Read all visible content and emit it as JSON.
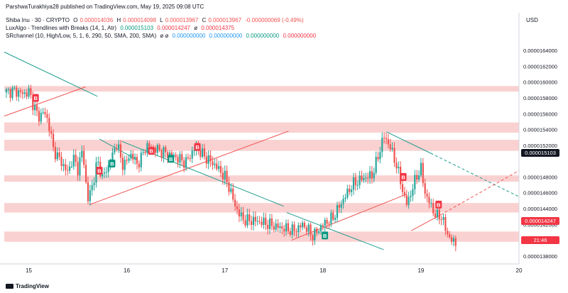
{
  "header": {
    "published": "ParshwaTurakhiya28 published on TradingView.com, May 19, 2025 09:08 UTC",
    "symbol": "Shiba Inu · 30 · CRYPTO",
    "ohlc": [
      {
        "k": "O",
        "v": "0.000014036"
      },
      {
        "k": "H",
        "v": "0.000014098"
      },
      {
        "k": "L",
        "v": "0.000013967"
      },
      {
        "k": "C",
        "v": "0.000013967"
      }
    ],
    "change": "-0.000000069 (-0.49%)",
    "ind1_name": "LuxAlgo - Trendlines with Breaks (14, 1, Atr)",
    "ind1_v1": "0.000015103",
    "ind1_v2": "0.000014247",
    "ind1_v3": "0.000014375",
    "ind1_sym": "ø",
    "ind2_name": "SRchannel (10, High/Low, 5, 1, 6, 290, 50, SMA, 200, SMA)",
    "ind2_sym": "ø ø",
    "ind2_values": [
      "0.000000000",
      "0.000000000",
      "0.000000000",
      "0.000000000"
    ],
    "currency": "USD",
    "footer": "TradingView"
  },
  "colors": {
    "up": "#26a69a",
    "down": "#ef5350",
    "zone": "#f9c9c9",
    "trend_down": "#1e9e8e",
    "trend_up": "#ef5350",
    "break_up": "#089981",
    "break_down": "#f23645",
    "axis_text": "#131722"
  },
  "chart_data": {
    "type": "candlestick",
    "symbol": "Shiba Inu · 30 · CRYPTO",
    "x_ticks": [
      "15",
      "16",
      "17",
      "18",
      "19",
      "20"
    ],
    "x_tick_days": [
      15,
      16,
      17,
      18,
      19,
      20
    ],
    "x_range_days": [
      14.75,
      20
    ],
    "y_range": [
      1.37e-05,
      1.65e-05
    ],
    "y_ticks": [
      {
        "v": 1.64e-05,
        "label": "0.0000164000"
      },
      {
        "v": 1.62e-05,
        "label": "0.0000162000"
      },
      {
        "v": 1.6e-05,
        "label": "0.0000160000"
      },
      {
        "v": 1.58e-05,
        "label": "0.0000158000"
      },
      {
        "v": 1.56e-05,
        "label": "0.0000156000"
      },
      {
        "v": 1.54e-05,
        "label": "0.0000154000"
      },
      {
        "v": 1.52e-05,
        "label": "0.0000152000"
      },
      {
        "v": 1.48e-05,
        "label": "0.0000148000"
      },
      {
        "v": 1.46e-05,
        "label": "0.0000146000"
      },
      {
        "v": 1.44e-05,
        "label": "0.0000144000"
      },
      {
        "v": 1.42e-05,
        "label": "0.0000142000"
      },
      {
        "v": 1.4e-05,
        "label": "0.0000140000"
      },
      {
        "v": 1.38e-05,
        "label": "0.0000138000"
      }
    ],
    "price_labels": [
      {
        "text": "0.000015103",
        "v": 1.5103e-05,
        "style": "box-dark"
      },
      {
        "text": "0.000014247",
        "v": 1.4247e-05,
        "style": "red"
      },
      {
        "text": "21:46",
        "v": 1.4e-05,
        "style": "red"
      }
    ],
    "zones": [
      [
        1.588e-05,
        1.595e-05
      ],
      [
        1.536e-05,
        1.549e-05
      ],
      [
        1.513e-05,
        1.527e-05
      ],
      [
        1.474e-05,
        1.482e-05
      ],
      [
        1.435e-05,
        1.447e-05
      ],
      [
        1.398e-05,
        1.411e-05
      ]
    ],
    "close_path": [
      [
        14.75,
        15.87
      ],
      [
        14.85,
        15.89
      ],
      [
        14.95,
        15.85
      ],
      [
        15.0,
        15.88
      ],
      [
        15.05,
        15.7
      ],
      [
        15.1,
        15.55
      ],
      [
        15.15,
        15.63
      ],
      [
        15.2,
        15.5
      ],
      [
        15.25,
        15.15
      ],
      [
        15.3,
        15.05
      ],
      [
        15.35,
        14.95
      ],
      [
        15.4,
        14.85
      ],
      [
        15.45,
        15.05
      ],
      [
        15.5,
        14.9
      ],
      [
        15.55,
        15.15
      ],
      [
        15.6,
        14.5
      ],
      [
        15.65,
        14.7
      ],
      [
        15.7,
        15.0
      ],
      [
        15.75,
        14.8
      ],
      [
        15.8,
        14.9
      ],
      [
        15.85,
        15.05
      ],
      [
        15.9,
        15.25
      ],
      [
        15.95,
        14.95
      ],
      [
        16.0,
        15.0
      ],
      [
        16.05,
        15.1
      ],
      [
        16.1,
        14.95
      ],
      [
        16.15,
        15.05
      ],
      [
        16.2,
        15.2
      ],
      [
        16.3,
        15.15
      ],
      [
        16.4,
        15.1
      ],
      [
        16.5,
        15.05
      ],
      [
        16.6,
        14.98
      ],
      [
        16.7,
        15.18
      ],
      [
        16.8,
        15.05
      ],
      [
        16.9,
        14.95
      ],
      [
        17.0,
        14.8
      ],
      [
        17.05,
        14.65
      ],
      [
        17.1,
        14.45
      ],
      [
        17.15,
        14.32
      ],
      [
        17.2,
        14.25
      ],
      [
        17.3,
        14.25
      ],
      [
        17.4,
        14.22
      ],
      [
        17.5,
        14.18
      ],
      [
        17.6,
        14.15
      ],
      [
        17.7,
        14.12
      ],
      [
        17.8,
        14.2
      ],
      [
        17.9,
        14.05
      ],
      [
        18.0,
        14.2
      ],
      [
        18.1,
        14.28
      ],
      [
        18.2,
        14.5
      ],
      [
        18.3,
        14.7
      ],
      [
        18.4,
        14.78
      ],
      [
        18.5,
        14.82
      ],
      [
        18.55,
        15.0
      ],
      [
        18.62,
        15.32
      ],
      [
        18.68,
        15.2
      ],
      [
        18.75,
        14.95
      ],
      [
        18.8,
        14.7
      ],
      [
        18.85,
        14.45
      ],
      [
        18.9,
        14.6
      ],
      [
        18.95,
        14.8
      ],
      [
        19.0,
        14.9
      ],
      [
        19.05,
        14.55
      ],
      [
        19.1,
        14.45
      ],
      [
        19.15,
        14.3
      ],
      [
        19.2,
        14.32
      ],
      [
        19.25,
        14.15
      ],
      [
        19.3,
        14.0
      ],
      [
        19.36,
        13.97
      ]
    ],
    "trendlines": [
      {
        "kind": "down",
        "from": [
          14.75,
          16.38
        ],
        "to": [
          15.7,
          15.82
        ],
        "dashed": false
      },
      {
        "kind": "up",
        "from": [
          14.75,
          15.57
        ],
        "to": [
          15.58,
          15.94
        ],
        "dashed": false
      },
      {
        "kind": "down",
        "from": [
          15.72,
          15.28
        ],
        "to": [
          16.1,
          15.02
        ],
        "dashed": false
      },
      {
        "kind": "up",
        "from": [
          15.62,
          14.45
        ],
        "to": [
          17.65,
          15.38
        ],
        "dashed": false
      },
      {
        "kind": "down",
        "from": [
          15.95,
          15.25
        ],
        "to": [
          17.6,
          14.43
        ],
        "dashed": false
      },
      {
        "kind": "down",
        "from": [
          17.63,
          14.35
        ],
        "to": [
          18.62,
          13.88
        ],
        "dashed": false
      },
      {
        "kind": "up",
        "from": [
          17.68,
          14.0
        ],
        "to": [
          18.85,
          14.58
        ],
        "dashed": false
      },
      {
        "kind": "down",
        "from": [
          18.65,
          15.37
        ],
        "to": [
          19.1,
          15.1
        ],
        "dashed": false
      },
      {
        "kind": "down",
        "from": [
          19.1,
          15.1
        ],
        "to": [
          20.0,
          14.55
        ],
        "dashed": true
      },
      {
        "kind": "up",
        "from": [
          18.9,
          14.12
        ],
        "to": [
          19.2,
          14.32
        ],
        "dashed": false
      },
      {
        "kind": "up",
        "from": [
          19.2,
          14.32
        ],
        "to": [
          20.0,
          14.88
        ],
        "dashed": true
      }
    ],
    "break_markers": [
      {
        "t": 15.07,
        "v": 15.8,
        "label": "B",
        "kind": "down"
      },
      {
        "t": 15.72,
        "v": 14.88,
        "label": "B",
        "kind": "down"
      },
      {
        "t": 15.85,
        "v": 14.97,
        "label": "B",
        "kind": "up"
      },
      {
        "t": 16.25,
        "v": 15.13,
        "label": "B",
        "kind": "down"
      },
      {
        "t": 16.45,
        "v": 15.03,
        "label": "B",
        "kind": "up"
      },
      {
        "t": 16.72,
        "v": 15.18,
        "label": "B",
        "kind": "down"
      },
      {
        "t": 18.02,
        "v": 14.06,
        "label": "B",
        "kind": "up"
      },
      {
        "t": 18.82,
        "v": 14.8,
        "label": "B",
        "kind": "down"
      },
      {
        "t": 19.18,
        "v": 14.45,
        "label": "B",
        "kind": "down"
      }
    ]
  }
}
